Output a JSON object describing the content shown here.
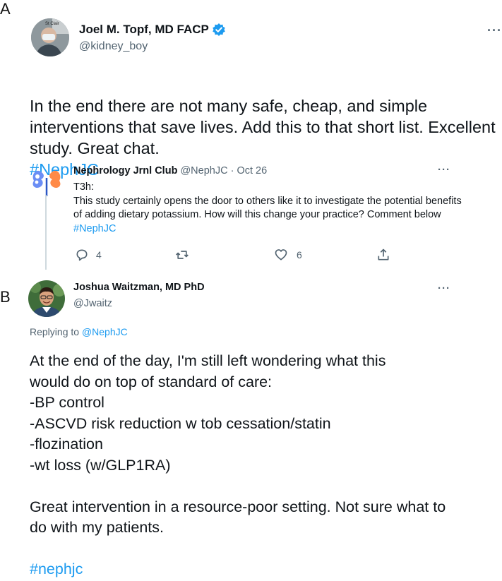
{
  "panels": {
    "a": "A",
    "b": "B"
  },
  "tweet1": {
    "name": "Joel M. Topf, MD FACP",
    "handle": "@kidney_boy",
    "avatar_text": "St Clair",
    "text": "In the end there are not many safe, cheap, and simple interventions that save lives. Add this to that short list. Excellent study. Great chat.",
    "hashtag": "#NephJC",
    "more": "···"
  },
  "quoted": {
    "name": "Nephrology Jrnl Club",
    "meta": "@NephJC · Oct 26",
    "more": "···",
    "line1": "T3h:",
    "text": "This study certainly opens the door to others like it to investigate the potential benefits of adding dietary potassium. How will this change your practice? Comment below",
    "hashtag": "#NephJC",
    "actions": {
      "replies": "4",
      "likes": "6"
    }
  },
  "reply": {
    "name": "Joshua Waitzman, MD PhD",
    "handle": "@Jwaitz",
    "more": "···",
    "replying_prefix": "Replying to",
    "replying_handle": "@NephJC",
    "text_lines": [
      "At the end of the day, I'm still left wondering what this",
      "would do on top of standard of care:",
      "-BP control",
      "-ASCVD risk reduction w tob cessation/statin",
      "-flozination",
      "-wt loss (w/GLP1RA)"
    ],
    "text_para2": "Great intervention in a resource-poor setting. Not sure what to do with my patients.",
    "hashtag": "#nephjc"
  },
  "colors": {
    "link": "#1d9bf0",
    "verified": "#1d9bf0",
    "muted": "#536471",
    "text": "#0f1419"
  }
}
